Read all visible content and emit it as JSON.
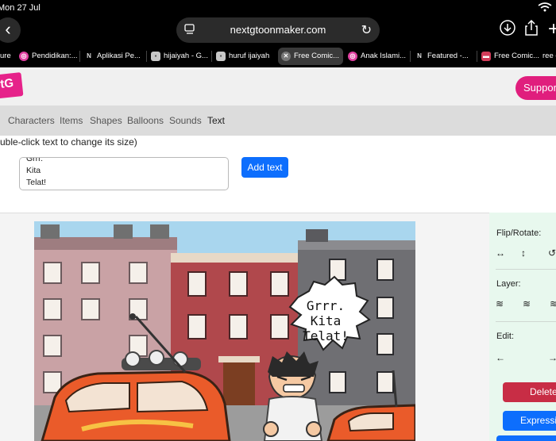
{
  "status": {
    "date": "Mon 27 Jul"
  },
  "browser": {
    "url": "nextgtoonmaker.com",
    "tabs": [
      {
        "label": "ure",
        "favicon": "none"
      },
      {
        "label": "Pendidikan:...",
        "favicon": "pink-icon"
      },
      {
        "label": "Aplikasi Pe...",
        "favicon": "N"
      },
      {
        "label": "hijaiyah - G...",
        "favicon": "grey-icon"
      },
      {
        "label": "huruf ijaiyah",
        "favicon": "grey-icon"
      },
      {
        "label": "Free Comic...",
        "favicon": "close-icon",
        "active": true
      },
      {
        "label": "Anak Islami...",
        "favicon": "pink-icon"
      },
      {
        "label": "Featured -...",
        "favicon": "N"
      },
      {
        "label": "Free Comic...",
        "favicon": "flag-icon"
      },
      {
        "label": "ree c",
        "favicon": "none"
      }
    ]
  },
  "app": {
    "logo": "tG",
    "support_label": "Support",
    "menu": [
      "Characters",
      "Items",
      "Shapes",
      "Balloons",
      "Sounds",
      "Text"
    ],
    "active_menu": "Text",
    "hint": "uble-click text to change its size)",
    "text_input_lines": [
      "Grrr.",
      "Kita",
      "Telat!"
    ],
    "add_text_label": "Add text"
  },
  "canvas": {
    "speech_bubble_lines": [
      "Grrr.",
      "Kita",
      "Telat!"
    ]
  },
  "panel": {
    "flip_rotate_label": "Flip/Rotate:",
    "layer_label": "Layer:",
    "edit_label": "Edit:",
    "delete_label": "Delete",
    "expressions_label": "Expressi"
  },
  "colors": {
    "accent_blue": "#0d6efd",
    "support_pink": "#e01e7d",
    "delete_red": "#c82d45",
    "panel_green": "#e8f8ee"
  }
}
